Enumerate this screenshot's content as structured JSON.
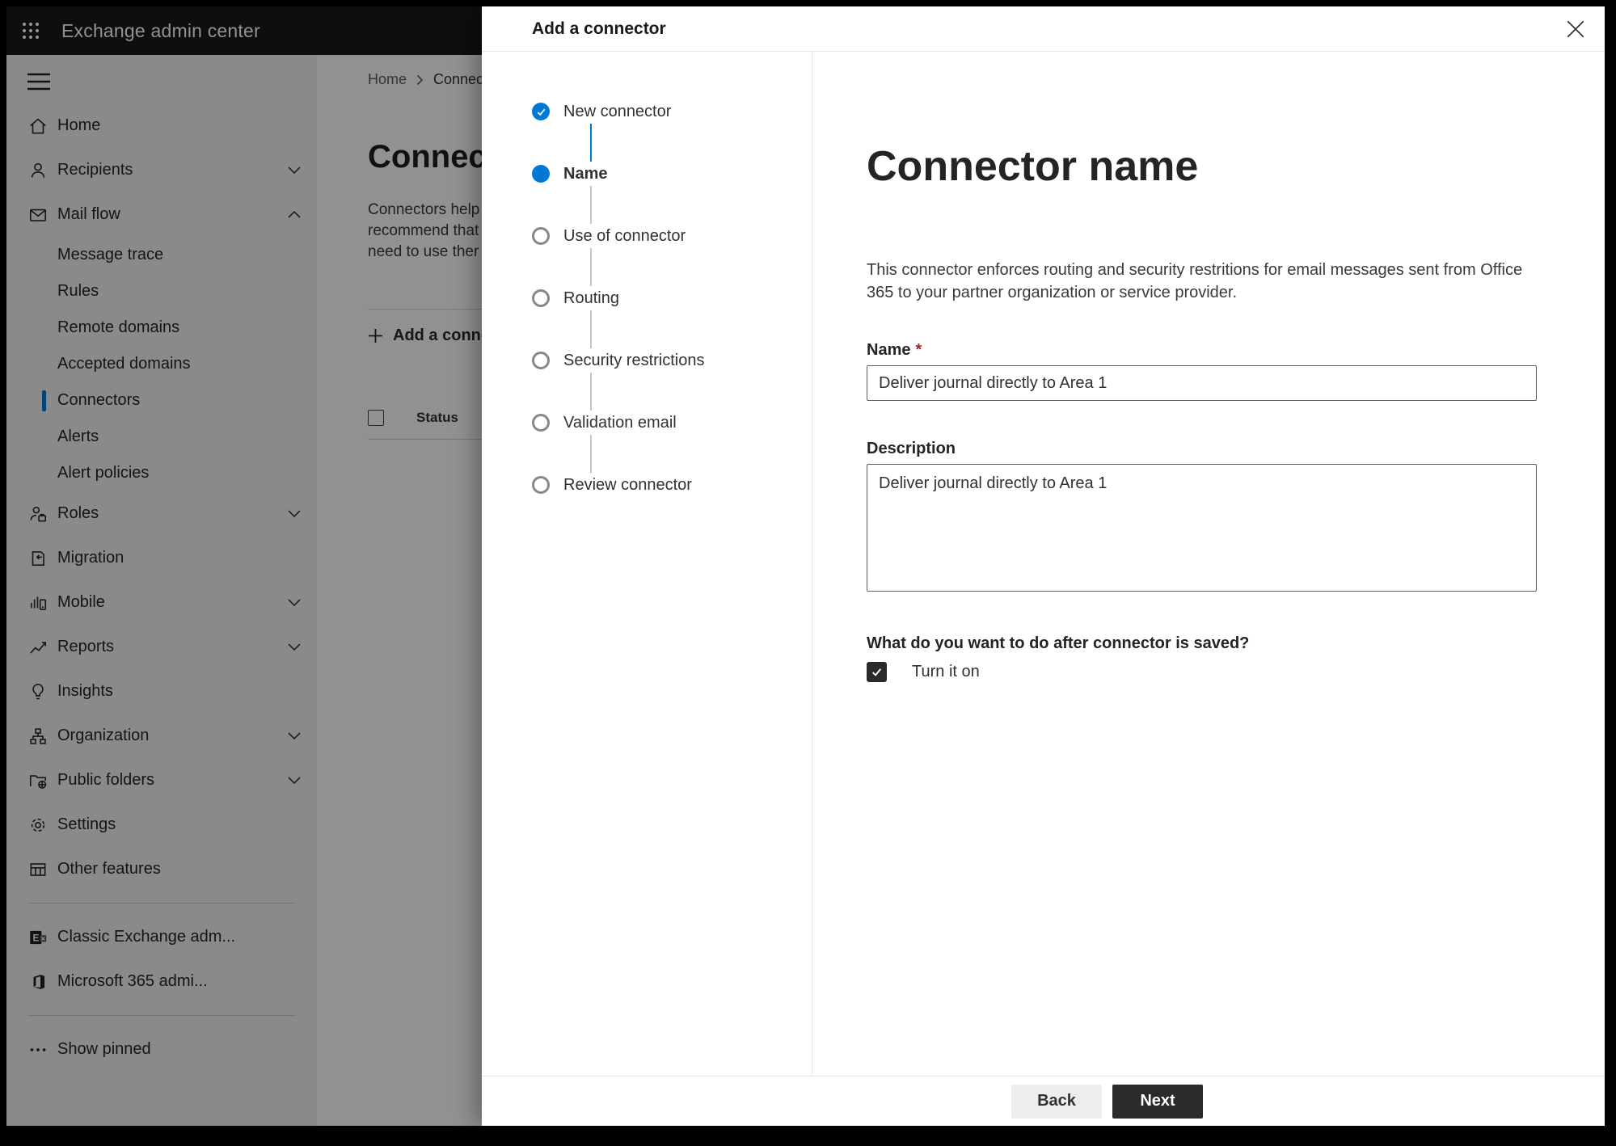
{
  "topbar": {
    "title": "Exchange admin center"
  },
  "sidebar": {
    "items": [
      {
        "label": "Home",
        "icon": "home-icon"
      },
      {
        "label": "Recipients",
        "icon": "person-icon",
        "chevron": "down"
      },
      {
        "label": "Mail flow",
        "icon": "mail-icon",
        "chevron": "up",
        "expanded": true
      },
      {
        "label": "Message trace",
        "type": "sub"
      },
      {
        "label": "Rules",
        "type": "sub"
      },
      {
        "label": "Remote domains",
        "type": "sub"
      },
      {
        "label": "Accepted domains",
        "type": "sub"
      },
      {
        "label": "Connectors",
        "type": "sub",
        "selected": true
      },
      {
        "label": "Alerts",
        "type": "sub"
      },
      {
        "label": "Alert policies",
        "type": "sub"
      },
      {
        "label": "Roles",
        "icon": "roles-icon",
        "chevron": "down"
      },
      {
        "label": "Migration",
        "icon": "migration-icon"
      },
      {
        "label": "Mobile",
        "icon": "mobile-icon",
        "chevron": "down"
      },
      {
        "label": "Reports",
        "icon": "reports-icon",
        "chevron": "down"
      },
      {
        "label": "Insights",
        "icon": "insights-icon"
      },
      {
        "label": "Organization",
        "icon": "organization-icon",
        "chevron": "down"
      },
      {
        "label": "Public folders",
        "icon": "public-folders-icon",
        "chevron": "down"
      },
      {
        "label": "Settings",
        "icon": "settings-icon"
      },
      {
        "label": "Other features",
        "icon": "other-features-icon"
      },
      {
        "label": "Classic Exchange adm...",
        "icon": "classic-exchange-icon"
      },
      {
        "label": "Microsoft 365 admi...",
        "icon": "microsoft-365-icon"
      },
      {
        "label": "Show pinned",
        "icon": "ellipsis-icon"
      }
    ]
  },
  "bg": {
    "breadcrumb": {
      "home": "Home",
      "current": "Connectors"
    },
    "heading": "Connectors",
    "paragraph_lines": [
      "Connectors help",
      "recommend that",
      "need to use ther"
    ],
    "add_button_label": "Add a connector",
    "status_header": "Status"
  },
  "dialog": {
    "title": "Add a connector",
    "steps": [
      {
        "label": "New connector",
        "state": "completed"
      },
      {
        "label": "Name",
        "state": "current"
      },
      {
        "label": "Use of connector",
        "state": "upcoming"
      },
      {
        "label": "Routing",
        "state": "upcoming"
      },
      {
        "label": "Security restrictions",
        "state": "upcoming"
      },
      {
        "label": "Validation email",
        "state": "upcoming"
      },
      {
        "label": "Review connector",
        "state": "upcoming"
      }
    ],
    "content": {
      "heading": "Connector name",
      "description": "This connector enforces routing and security restritions for email messages sent from Office 365 to your partner organization or service provider.",
      "name_label": "Name",
      "name_required_marker": "*",
      "name_value": "Deliver journal directly to Area 1",
      "description_label": "Description",
      "description_value": "Deliver journal directly to Area 1",
      "after_save_question": "What do you want to do after connector is saved?",
      "turn_on_label": "Turn it on",
      "turn_on_checked": true
    },
    "footer": {
      "back_label": "Back",
      "next_label": "Next"
    }
  },
  "colors": {
    "accent": "#0078d4",
    "topbar_bg": "#1a1a1a",
    "sidebar_bg": "#f3f2f1",
    "required_marker": "#a4262c",
    "primary_button_bg": "#2b2a29",
    "secondary_button_bg": "#ededed",
    "step_upcoming_border": "#8a8886"
  }
}
